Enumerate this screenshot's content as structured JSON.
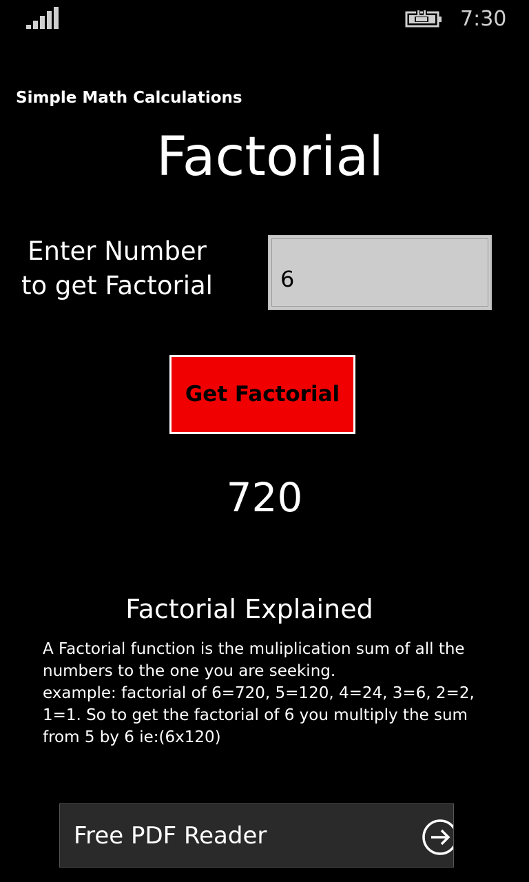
{
  "status_bar": {
    "time": "7:30",
    "signal_icon": "signal-bars-icon",
    "battery_icon": "battery-charging-icon"
  },
  "app": {
    "title": "Simple Math Calculations"
  },
  "page": {
    "title": "Factorial"
  },
  "input": {
    "label_line1": "Enter Number",
    "label_line2": "to get Factorial",
    "value": "6"
  },
  "button": {
    "label": "Get Factorial"
  },
  "result": {
    "value": "720"
  },
  "explanation": {
    "heading": "Factorial Explained",
    "lines": [
      "A Factorial function is the muliplication sum of all the",
      "numbers to the one you are seeking.",
      "example: factorial of 6=720, 5=120, 4=24, 3=6, 2=2,",
      "1=1.  So to get the factorial of 6 you multiply the sum",
      "from 5 by 6 ie:(6x120)"
    ]
  },
  "ad": {
    "text": "Free PDF Reader",
    "icon": "arrow-right-circle-icon"
  },
  "colors": {
    "background": "#000000",
    "button": "#f00000",
    "input_bg": "#cccccc",
    "ad_bg": "#2a2a2a"
  }
}
